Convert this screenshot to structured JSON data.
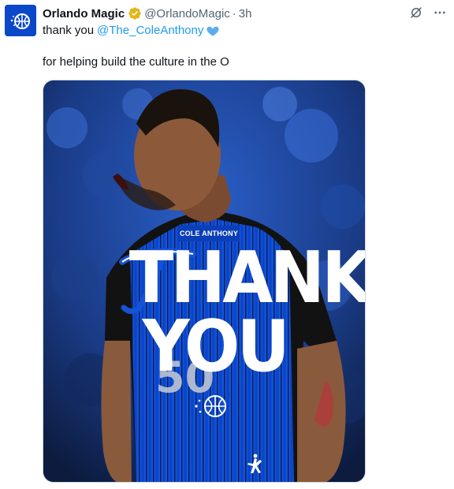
{
  "tweet": {
    "display_name": "Orlando Magic",
    "handle": "@OrlandoMagic",
    "separator": "·",
    "time": "3h",
    "line1_text": "thank you",
    "mention": "@The_ColeAnthony",
    "line2_text": "for helping build the culture in the O"
  },
  "media": {
    "name_tag": "COLE ANTHONY",
    "headline_top": "THANK",
    "headline_bottom": "YOU",
    "jersey_number": "50"
  },
  "icons": {
    "avatar": "orlando-magic-logo",
    "verified": "gold-verified-badge",
    "heart": "blue-heart-emoji",
    "grok": "grok-icon",
    "more": "more-icon"
  },
  "colors": {
    "accent_link": "#1d9bf0",
    "magic_blue": "#0a48c9",
    "verified_gold": "#e2b719"
  }
}
